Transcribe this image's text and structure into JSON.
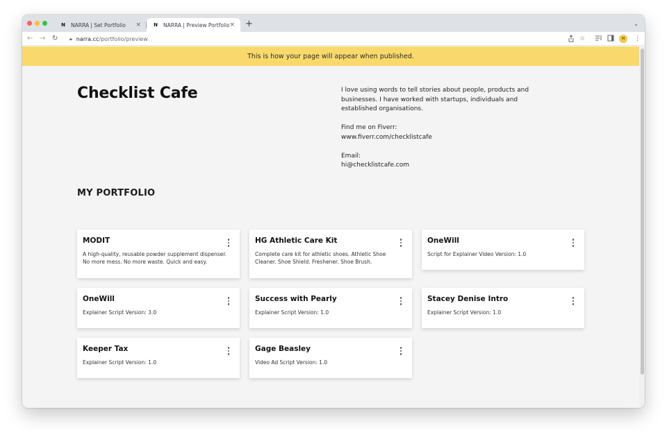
{
  "browser": {
    "tabs": [
      {
        "favicon": "N",
        "title": "NARRA | Set Portfolio",
        "close": "×"
      },
      {
        "favicon": "N",
        "title": "NARRA | Preview Portfolio",
        "close": "×"
      }
    ],
    "new_tab": "+",
    "tab_search": "⌄",
    "url_host": "narra.cc",
    "url_path": "/portfolio/preview",
    "avatar": "H"
  },
  "banner": {
    "text": "This is how your page will appear when published."
  },
  "profile": {
    "name": "Checklist Cafe",
    "bio": "I love using words to tell stories about people, products and businesses. I have worked with startups, individuals and established organisations.",
    "fiverr_label": "Find me on Fiverr:",
    "fiverr_url": "www.fiverr.com/checklistcafe",
    "email_label": "Email:",
    "email": "hi@checklistcafe.com"
  },
  "portfolio": {
    "heading": "MY PORTFOLIO",
    "items": [
      {
        "title": "MODIT",
        "description": "A high-quality, reusable powder supplement dispenser. No more mess. No more waste. Quick and easy."
      },
      {
        "title": "HG Athletic Care Kit",
        "description": "Complete care kit for athletic shoes. Athletic Shoe Cleaner. Shoe Shield. Freshener. Shoe Brush."
      },
      {
        "title": "OneWill",
        "description": "Script for Explainer Video Version: 1.0"
      },
      {
        "title": "OneWill",
        "description": "Explainer Script Version: 3.0"
      },
      {
        "title": "Success with Pearly",
        "description": "Explainer Script Version: 1.0"
      },
      {
        "title": "Stacey Denise Intro",
        "description": "Explainer Script Version: 1.0"
      },
      {
        "title": "Keeper Tax",
        "description": "Explainer Script Version: 1.0"
      },
      {
        "title": "Gage Beasley",
        "description": "Video Ad Script Version: 1.0"
      }
    ]
  },
  "colors": {
    "banner": "#f9d96b",
    "page_background": "#f4f4f4",
    "card_background": "#ffffff"
  }
}
